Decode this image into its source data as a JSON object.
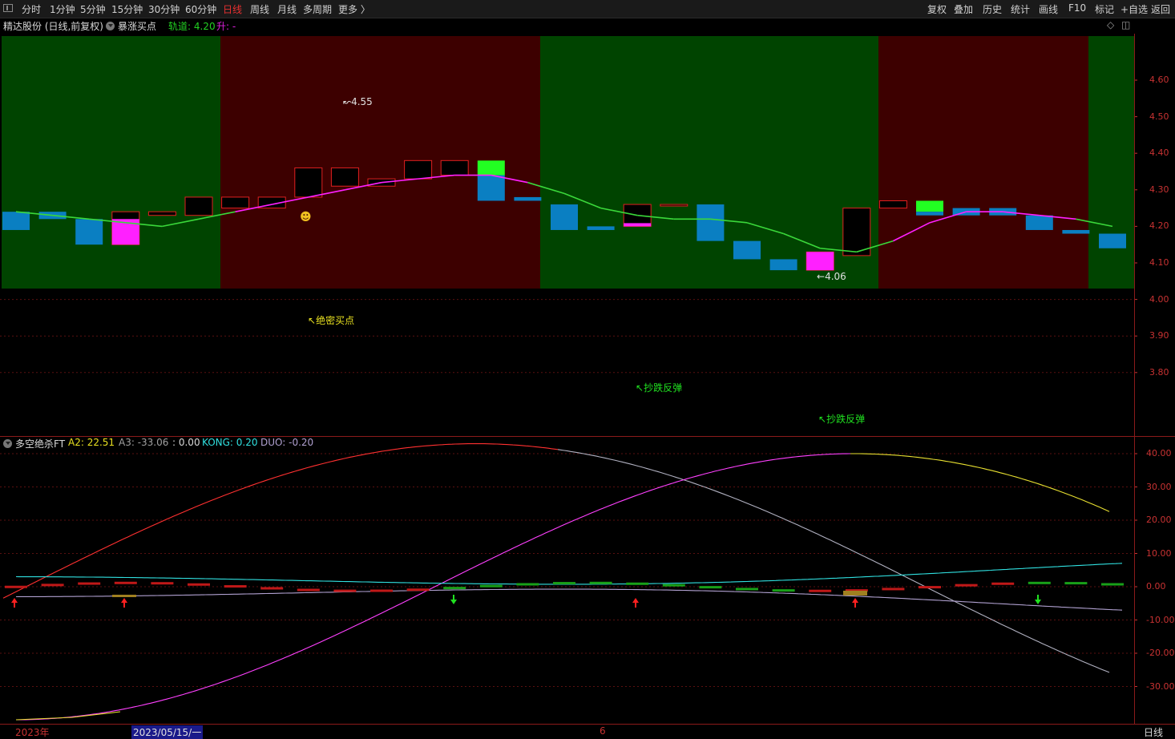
{
  "toolbar": {
    "periods": [
      "分时",
      "1分钟",
      "5分钟",
      "15分钟",
      "30分钟",
      "60分钟",
      "日线",
      "周线",
      "月线",
      "多周期",
      "更多 〉"
    ],
    "active_period": "日线",
    "right_buttons": [
      "复权",
      "叠加",
      "历史",
      "统计",
      "画线",
      "F10",
      "标记",
      "+自选",
      "返回"
    ]
  },
  "main_info": {
    "stock": "精达股份 (日线,前复权)",
    "indicator": "暴涨买点",
    "track_label": "轨道: 4.20",
    "rise_label": "升: -"
  },
  "main_axis": [
    "4.60",
    "4.50",
    "4.40",
    "4.30",
    "4.20",
    "4.10",
    "4.00",
    "3.90",
    "3.80"
  ],
  "annotations": {
    "high": "4.55",
    "low": "4.06",
    "secret_buy": "绝密买点",
    "rebound1": "抄跌反弹",
    "rebound2": "抄跌反弹"
  },
  "indicator_info": {
    "name": "多空绝杀FT",
    "a2": "A2: 22.51",
    "a3": "A3: -33.06",
    "colon_val": ": 0.00",
    "kong": "KONG: 0.20",
    "duo": "DUO: -0.20"
  },
  "ind_axis": [
    "40.00",
    "30.00",
    "20.00",
    "10.00",
    "0.00",
    "-10.00",
    "-20.00",
    "-30.00"
  ],
  "bottom": {
    "year": "2023年",
    "date": "2023/05/15/一",
    "month": "6",
    "period": "日线"
  },
  "colors": {
    "green_zone": "#004400",
    "red_zone": "#3d0000",
    "blue_bar": "#0a7fc2",
    "magenta": "#ff20ff",
    "lime": "#22ff22",
    "axis_red": "#c83232"
  },
  "chart_data": [
    {
      "type": "candlestick",
      "title": "精达股份 (日线,前复权)",
      "price_range": [
        3.7,
        4.66
      ],
      "candles": [
        {
          "open": 4.24,
          "close": 4.19,
          "color": "blue"
        },
        {
          "open": 4.24,
          "close": 4.22,
          "color": "blue"
        },
        {
          "open": 4.22,
          "close": 4.15,
          "color": "blue"
        },
        {
          "open": 4.22,
          "close": 4.15,
          "color": "magenta",
          "top": 4.24
        },
        {
          "open": 4.23,
          "close": 4.24,
          "color": "hollow"
        },
        {
          "open": 4.23,
          "close": 4.28,
          "color": "hollow"
        },
        {
          "open": 4.25,
          "close": 4.28,
          "color": "hollow"
        },
        {
          "open": 4.25,
          "close": 4.28,
          "color": "hollow"
        },
        {
          "open": 4.28,
          "close": 4.36,
          "color": "hollow"
        },
        {
          "open": 4.31,
          "close": 4.36,
          "color": "hollow"
        },
        {
          "open": 4.31,
          "close": 4.33,
          "color": "hollow"
        },
        {
          "open": 4.33,
          "close": 4.38,
          "color": "hollow"
        },
        {
          "open": 4.34,
          "close": 4.38,
          "color": "hollow"
        },
        {
          "open": 4.34,
          "close": 4.38,
          "color": "lime",
          "lower": 4.27
        },
        {
          "open": 4.28,
          "close": 4.27,
          "color": "blue"
        },
        {
          "open": 4.26,
          "close": 4.19,
          "color": "blue"
        },
        {
          "open": 4.2,
          "close": 4.19,
          "color": "blue"
        },
        {
          "open": 4.2,
          "close": 4.26,
          "color": "hollow",
          "mag": true
        },
        {
          "open": 4.26,
          "close": 4.26,
          "color": "hollow"
        },
        {
          "open": 4.26,
          "close": 4.16,
          "color": "blue"
        },
        {
          "open": 4.16,
          "close": 4.11,
          "color": "blue"
        },
        {
          "open": 4.11,
          "close": 4.08,
          "color": "blue"
        },
        {
          "open": 4.08,
          "close": 4.13,
          "color": "magenta",
          "top": 4.13
        },
        {
          "open": 4.12,
          "close": 4.25,
          "color": "hollow"
        },
        {
          "open": 4.25,
          "close": 4.27,
          "color": "hollow"
        },
        {
          "open": 4.24,
          "close": 4.27,
          "color": "lime",
          "lower": 4.23
        },
        {
          "open": 4.25,
          "close": 4.23,
          "color": "blue"
        },
        {
          "open": 4.25,
          "close": 4.23,
          "color": "blue"
        },
        {
          "open": 4.23,
          "close": 4.19,
          "color": "blue"
        },
        {
          "open": 4.19,
          "close": 4.18,
          "color": "blue"
        },
        {
          "open": 4.18,
          "close": 4.14,
          "color": "blue"
        }
      ],
      "track_line": [
        4.24,
        4.23,
        4.22,
        4.21,
        4.2,
        4.22,
        4.24,
        4.26,
        4.28,
        4.3,
        4.32,
        4.33,
        4.34,
        4.34,
        4.32,
        4.29,
        4.25,
        4.23,
        4.22,
        4.22,
        4.21,
        4.18,
        4.14,
        4.13,
        4.16,
        4.21,
        4.24,
        4.24,
        4.23,
        4.22,
        4.2
      ]
    },
    {
      "type": "line",
      "title": "多空绝杀FT",
      "ylim": [
        -40,
        43
      ],
      "series": [
        {
          "name": "A2",
          "color": "#ff3030"
        },
        {
          "name": "A3",
          "color": "#ff40ff"
        },
        {
          "name": "KONG",
          "color": "#30e0e0"
        },
        {
          "name": "DUO",
          "color": "#b0a0d0"
        }
      ]
    }
  ]
}
